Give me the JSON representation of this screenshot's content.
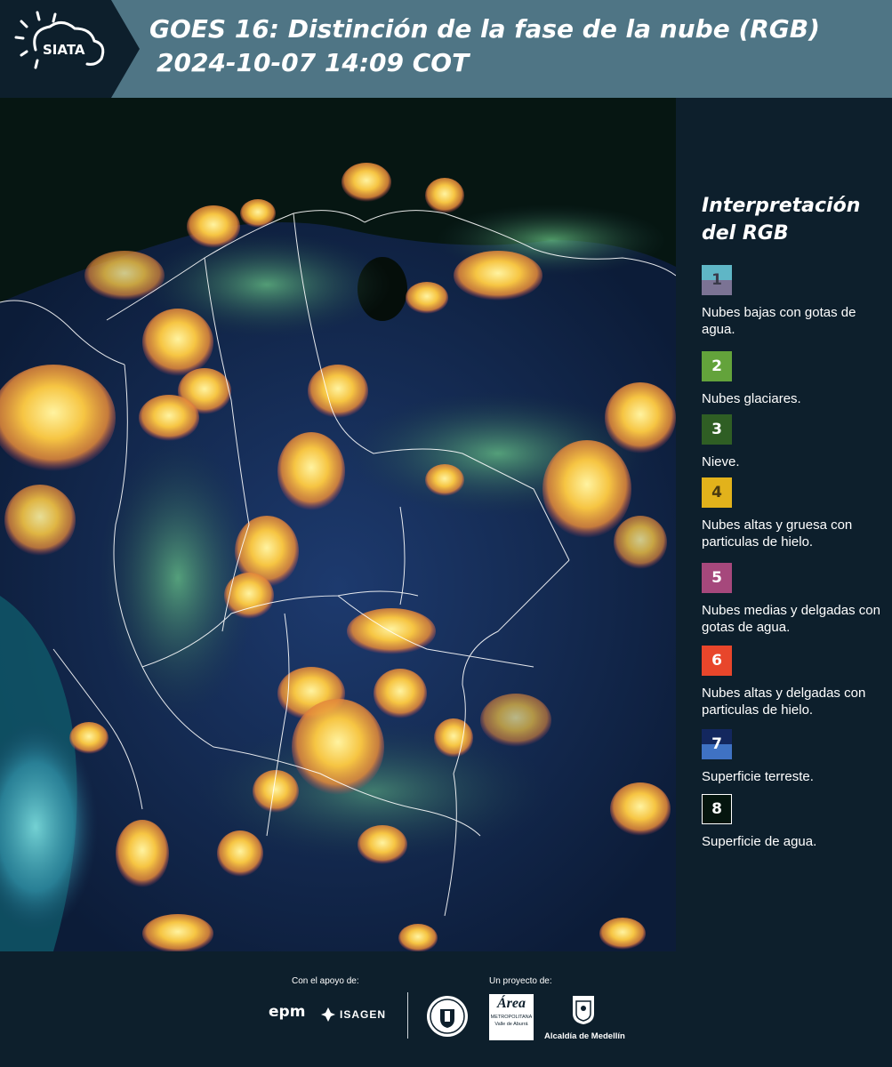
{
  "header": {
    "logo_text": "SIATA",
    "title_line1": "GOES 16: Distinción de la fase de la nube (RGB)",
    "title_line2": "2024-10-07 14:09 COT",
    "bg_color": "#4f7585"
  },
  "legend": {
    "title_line1": "Interpretación",
    "title_line2": "del RGB",
    "items": [
      {
        "num": "1",
        "label": "Nubes bajas con gotas de agua.",
        "color": "#5fb6c6",
        "color2": "#7b7394"
      },
      {
        "num": "2",
        "label": "Nubes glaciares.",
        "color": "#63a33b"
      },
      {
        "num": "3",
        "label": "Nieve.",
        "color": "#2f5e24"
      },
      {
        "num": "4",
        "label": "Nubes altas y gruesa con particulas de hielo.",
        "color": "#e2b21b"
      },
      {
        "num": "5",
        "label": "Nubes medias y delgadas con gotas de agua.",
        "color": "#a6487c"
      },
      {
        "num": "6",
        "label": "Nubes altas y delgadas con particulas de hielo.",
        "color": "#e8462b"
      },
      {
        "num": "7",
        "label": "Superficie terreste.",
        "color": "#13275e",
        "color2": "#3f72c3"
      },
      {
        "num": "8",
        "label": "Superficie de agua.",
        "color": "#05150e"
      }
    ]
  },
  "footer": {
    "support_text": "Con el apoyo de:",
    "project_text": "Un proyecto de:",
    "epm": "epm",
    "isagen": "ISAGEN",
    "area_line1": "Área",
    "area_line2": "METROPOLITANA",
    "area_line3": "Valle de Aburrá",
    "alcaldia": "Alcaldía de Medellín"
  }
}
